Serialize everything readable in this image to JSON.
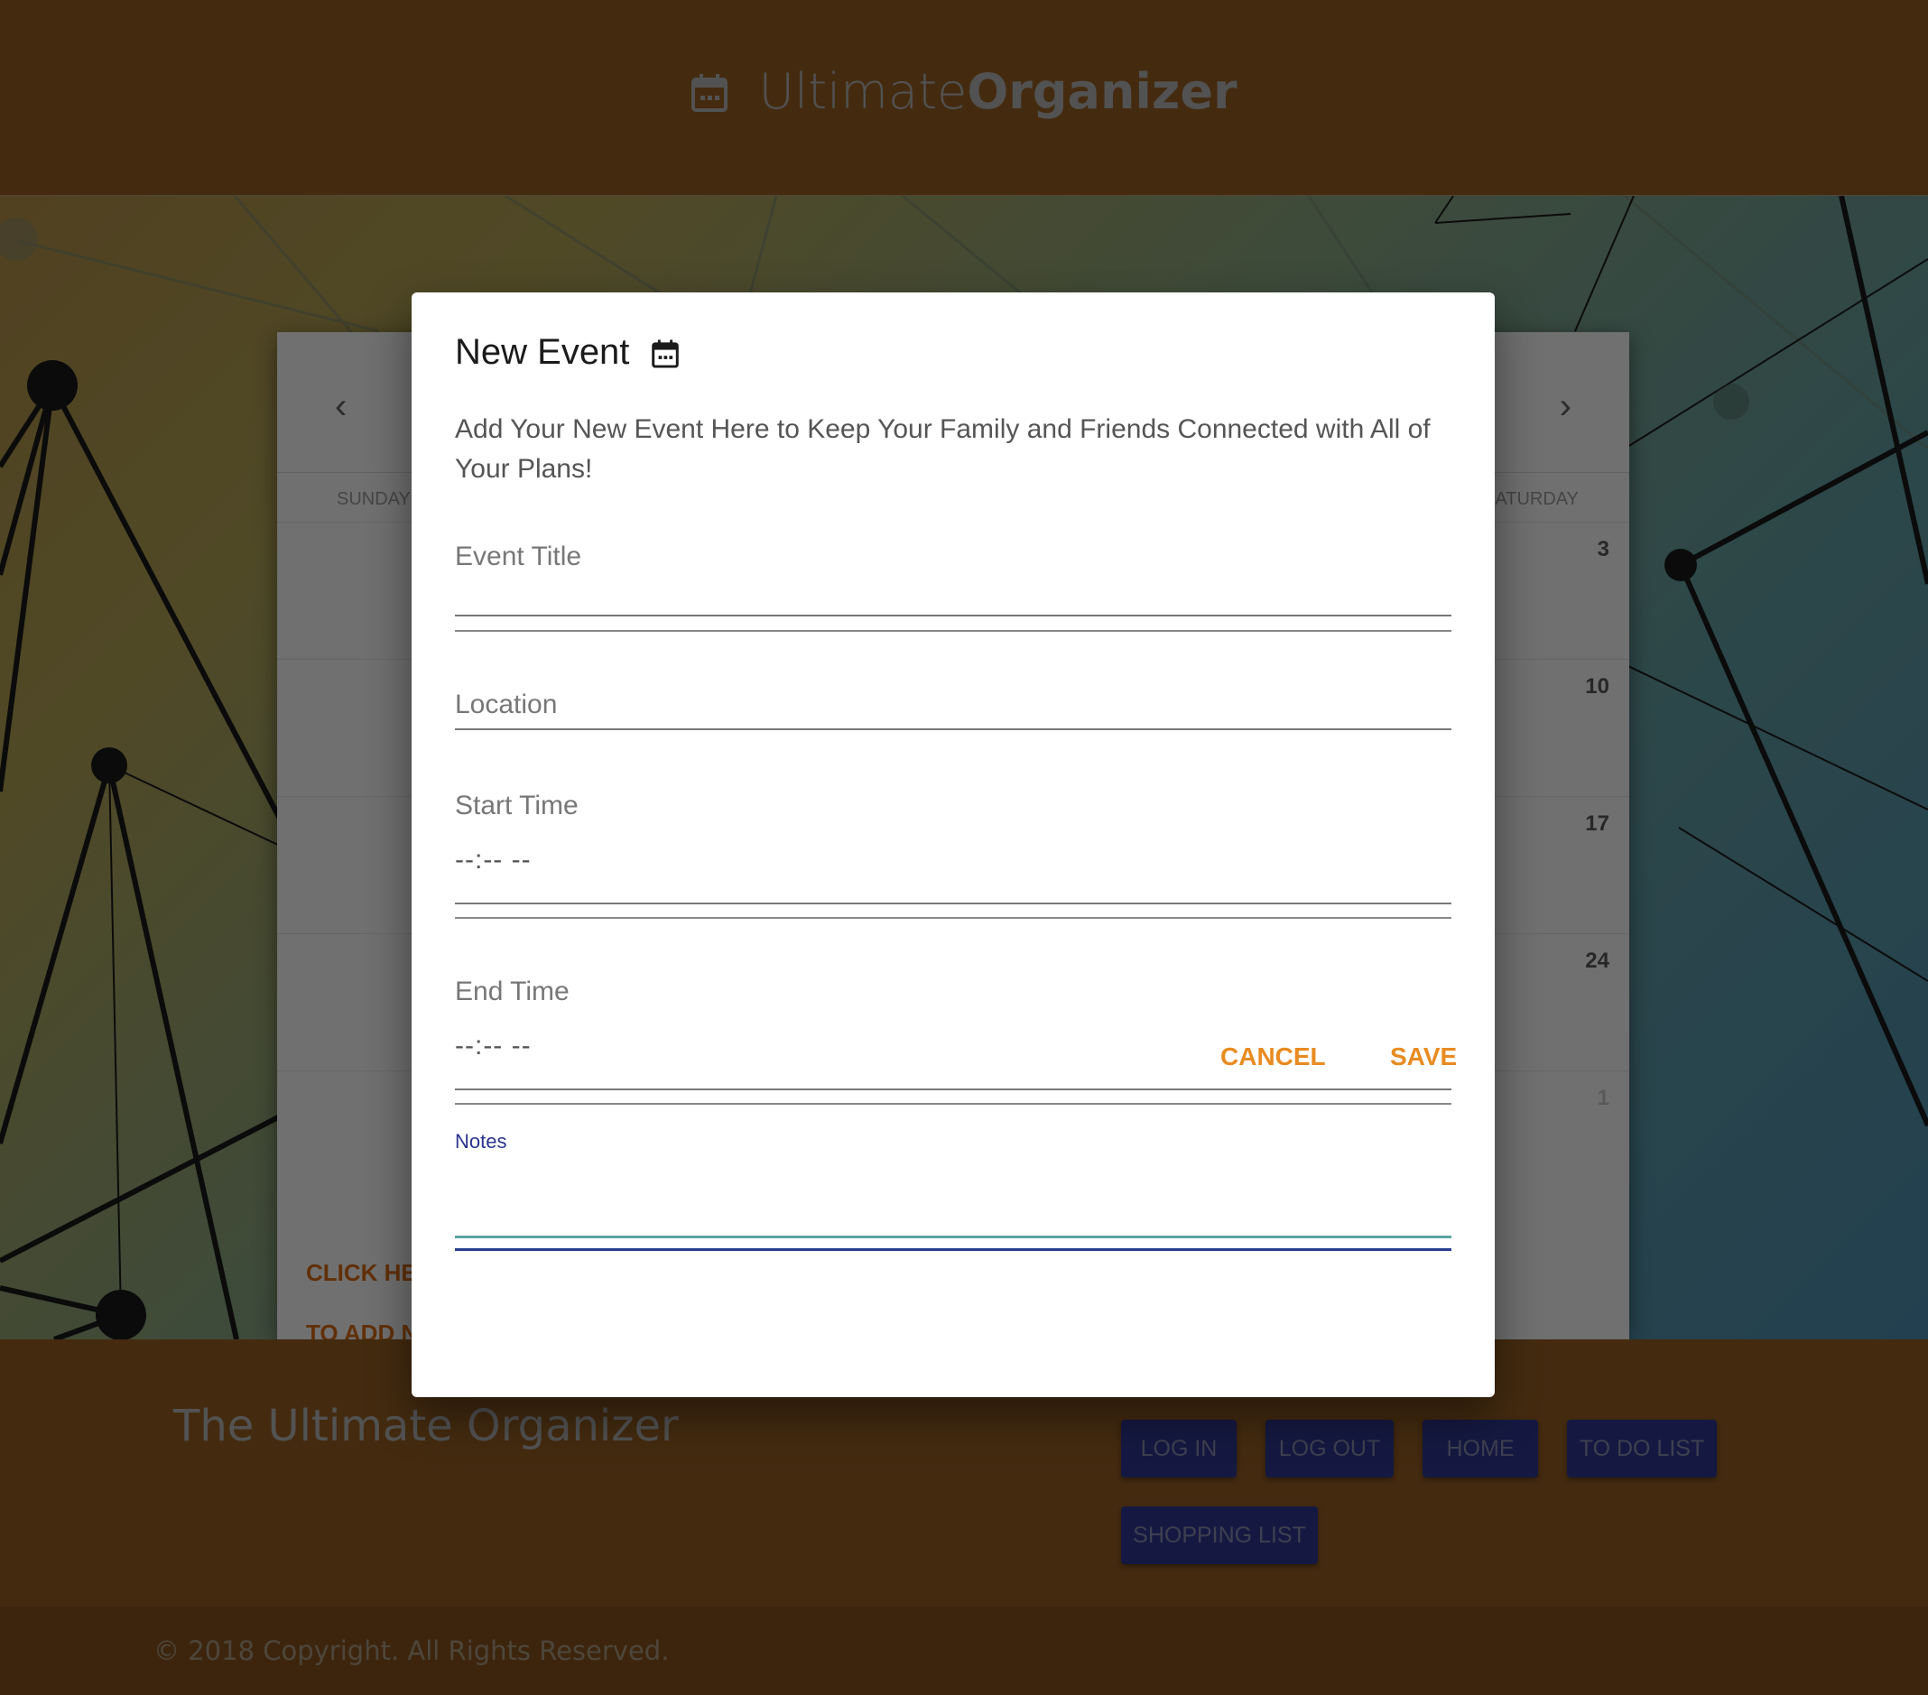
{
  "header": {
    "brand_light": "Ultimate",
    "brand_bold": "Organizer",
    "icon": "calendar-icon"
  },
  "calendar": {
    "prev_icon": "chevron-left-icon",
    "next_icon": "chevron-right-icon",
    "prev_glyph": "‹",
    "next_glyph": "›",
    "days": [
      "SUNDAY",
      "SATURDAY"
    ],
    "day_dates": [
      "3",
      "10",
      "17",
      "24",
      "1"
    ],
    "link_line1": "CLICK HE",
    "link_line2": "TO ADD N"
  },
  "modal": {
    "title": "New Event",
    "title_icon": "calendar-icon",
    "description": "Add Your New Event Here to Keep Your Family and Friends Connected with All of Your Plans!",
    "fields": {
      "event_title": "Event Title",
      "location": "Location",
      "start_time": "Start Time",
      "start_time_value": "--:-- --",
      "end_time": "End Time",
      "end_time_value": "--:-- --",
      "notes": "Notes"
    },
    "cancel_label": "CANCEL",
    "save_label": "SAVE",
    "accent_color": "#e88b21"
  },
  "footer": {
    "title": "The Ultimate Organizer",
    "nav": [
      "LOG IN",
      "LOG OUT",
      "HOME",
      "TO DO LIST",
      "SHOPPING LIST"
    ],
    "copyright": "© 2018 Copyright. All Rights Reserved."
  },
  "colors": {
    "header_bg": "#754a1c",
    "button_bg": "#252c72"
  }
}
